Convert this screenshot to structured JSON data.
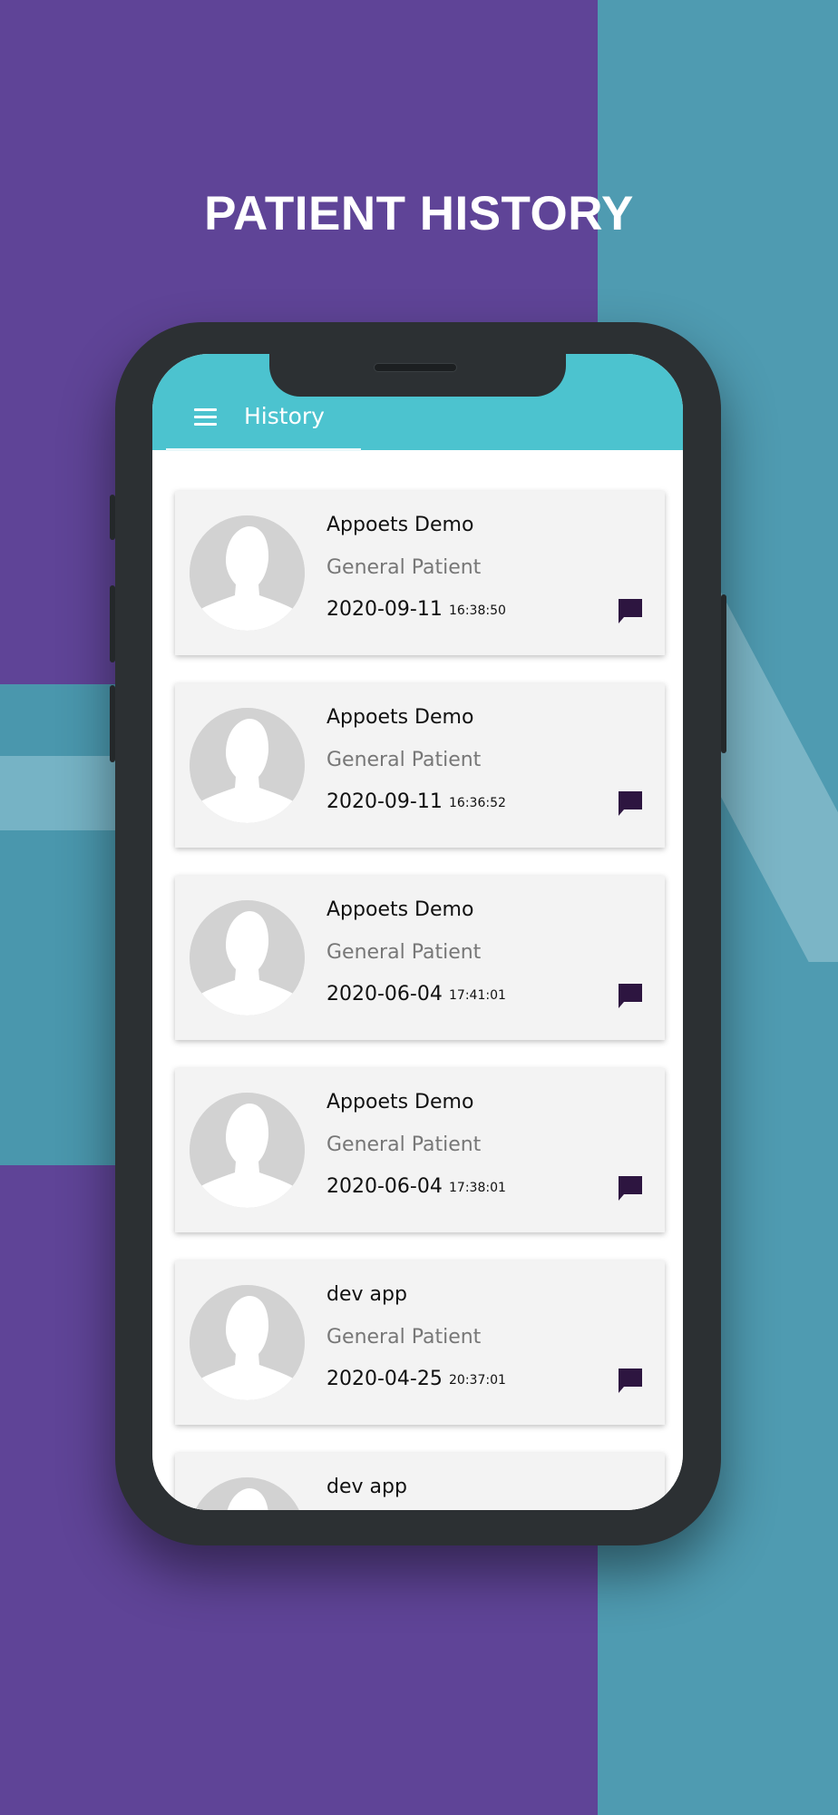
{
  "page_title": "PATIENT HISTORY",
  "app_bar": {
    "title": "History",
    "menu_icon": "menu-icon"
  },
  "colors": {
    "accent": "#4cc3cf",
    "background_left": "#5f4497",
    "background_right": "#4f9bb1",
    "chat_icon": "#2d1540"
  },
  "history": [
    {
      "name": "Appoets Demo",
      "type": "General Patient",
      "date": "2020-09-11",
      "time": "16:38:50"
    },
    {
      "name": "Appoets Demo",
      "type": "General Patient",
      "date": "2020-09-11",
      "time": "16:36:52"
    },
    {
      "name": "Appoets Demo",
      "type": "General Patient",
      "date": "2020-06-04",
      "time": "17:41:01"
    },
    {
      "name": "Appoets Demo",
      "type": "General Patient",
      "date": "2020-06-04",
      "time": "17:38:01"
    },
    {
      "name": "dev app",
      "type": "General Patient",
      "date": "2020-04-25",
      "time": "20:37:01"
    },
    {
      "name": "dev app",
      "type": "",
      "date": "",
      "time": ""
    }
  ]
}
